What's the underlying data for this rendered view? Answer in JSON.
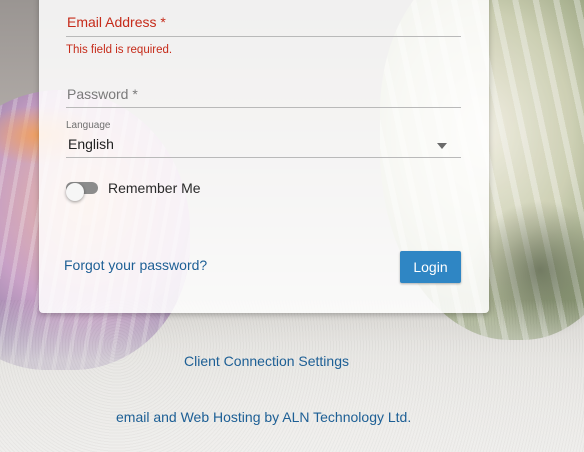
{
  "form": {
    "email": {
      "label": "Email Address *",
      "value": "",
      "error": "This field is required."
    },
    "password": {
      "label": "Password *",
      "value": ""
    },
    "language": {
      "label": "Language",
      "selected": "English"
    },
    "remember": {
      "label": "Remember Me",
      "checked": false
    },
    "forgot_label": "Forgot your password?",
    "login_label": "Login"
  },
  "footer": {
    "client_settings_label": "Client Connection Settings",
    "hosting_text": "email and Web Hosting by ALN Technology Ltd."
  },
  "colors": {
    "error": "#c62b1a",
    "link": "#1d5f95",
    "primary_button": "#2f86c4"
  },
  "icons": {
    "language_caret": "chevron-down-icon"
  }
}
